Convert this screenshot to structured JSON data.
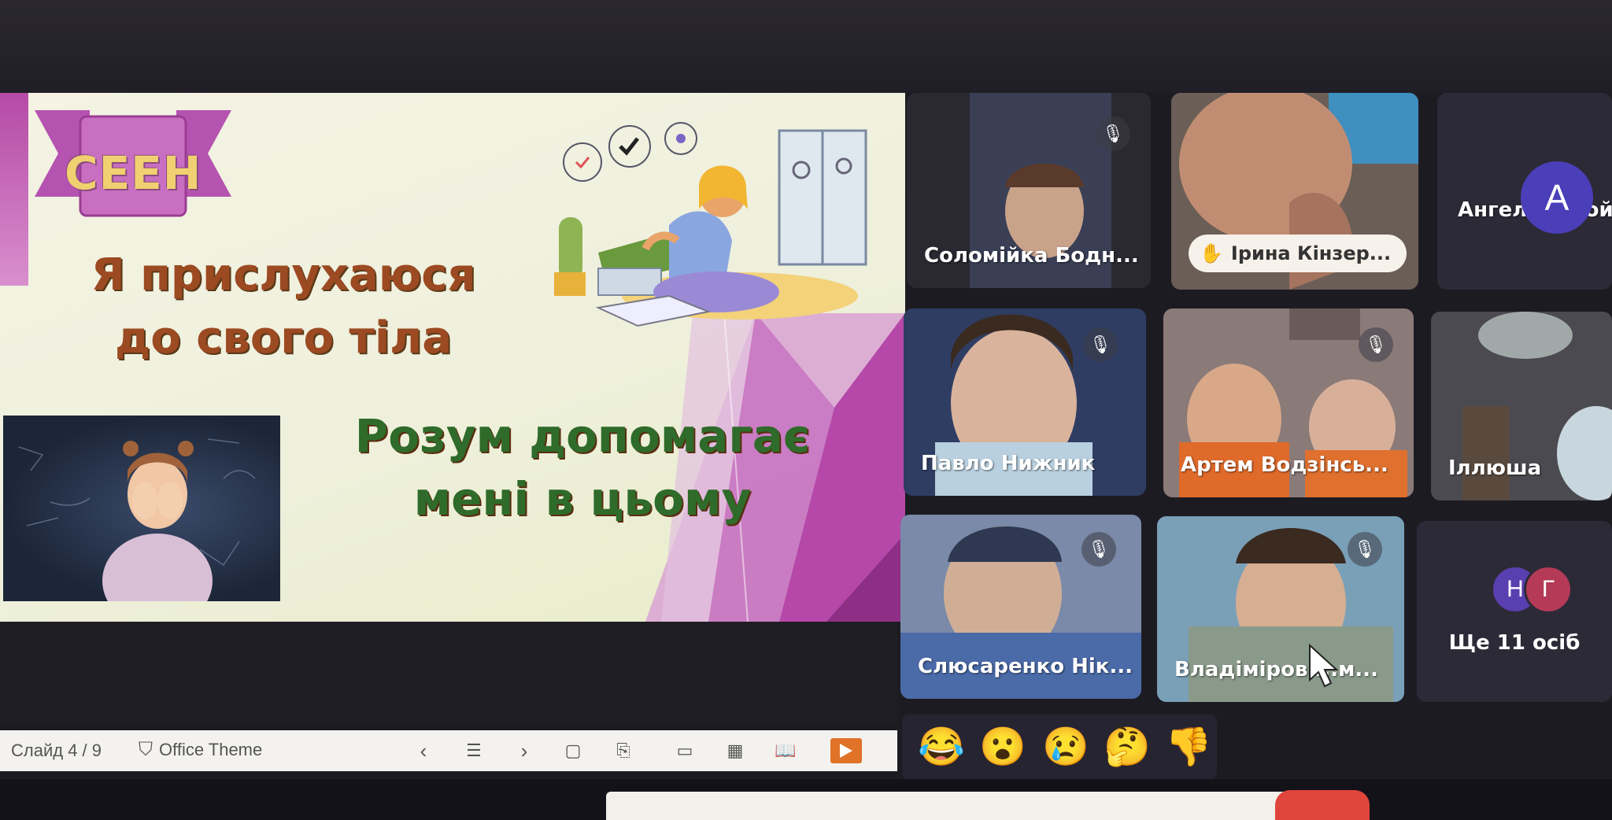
{
  "slide": {
    "badge_text": "CEEH",
    "title_line1": "Я прислухаюся",
    "title_line2": "до свого тіла",
    "subtitle_line1": "Розум допомагає",
    "subtitle_line2": "мені в цьому"
  },
  "toolbar": {
    "slide_counter": "Слайд 4 / 9",
    "theme_label": "Office Theme",
    "icons": [
      "previous-icon",
      "outline-icon",
      "next-icon",
      "notes-icon",
      "present-icon",
      "panel-icon",
      "grid-icon",
      "reader-icon",
      "play-icon"
    ]
  },
  "participants": [
    {
      "name": "Соломійка Бодн...",
      "muted": true
    },
    {
      "name": "Ірина Кінзер...",
      "hand_raised": true
    },
    {
      "name": "Ангеліна Войт",
      "avatar_letter": "А",
      "avatar_color": "#4a3fb8"
    },
    {
      "name": "Павло Нижник",
      "muted": true
    },
    {
      "name": "Артем Водзінсь...",
      "muted": true
    },
    {
      "name": "Іллюша"
    },
    {
      "name": "Слюсаренко Нік...",
      "muted": true
    },
    {
      "name": "Владіміров ...м...",
      "muted": true
    }
  ],
  "more": {
    "label": "Ще 11 осіб",
    "avatars": [
      {
        "letter": "Н",
        "color": "#5a3fb0"
      },
      {
        "letter": "Г",
        "color": "#b53a57"
      }
    ]
  },
  "reactions": [
    "😂",
    "😮",
    "😢",
    "🤔",
    "👎"
  ]
}
